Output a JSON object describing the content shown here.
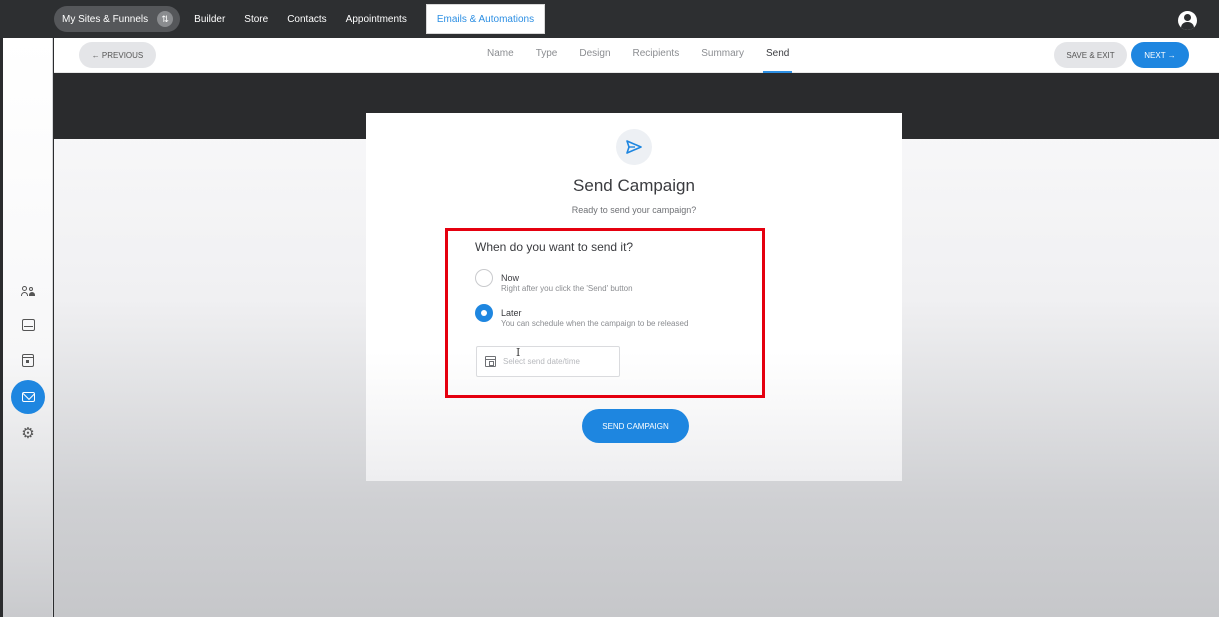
{
  "topnav": {
    "sites_label": "My Sites & Funnels",
    "items": [
      "Builder",
      "Store",
      "Contacts",
      "Appointments"
    ],
    "active_label": "Emails & Automations"
  },
  "toolbar": {
    "previous_label": "← PREVIOUS",
    "save_exit_label": "SAVE & EXIT",
    "next_label": "NEXT →"
  },
  "steps": [
    {
      "label": "Name",
      "active": false
    },
    {
      "label": "Type",
      "active": false
    },
    {
      "label": "Design",
      "active": false
    },
    {
      "label": "Recipients",
      "active": false
    },
    {
      "label": "Summary",
      "active": false
    },
    {
      "label": "Send",
      "active": true
    }
  ],
  "sidebar": {
    "icons": [
      "contacts-icon",
      "inbox-icon",
      "calendar-icon",
      "mail-icon",
      "settings-icon"
    ],
    "active": "mail-icon"
  },
  "card": {
    "title": "Send Campaign",
    "subtitle": "Ready to send your campaign?",
    "question": "When do you want to send it?",
    "options": [
      {
        "label": "Now",
        "description": "Right after you click the 'Send' button",
        "selected": false
      },
      {
        "label": "Later",
        "description": "You can schedule when the campaign to be released",
        "selected": true
      }
    ],
    "date_placeholder": "Select send date/time",
    "send_button": "SEND CAMPAIGN"
  },
  "colors": {
    "accent": "#1e86e0",
    "highlight_border": "#e5000f",
    "topbar": "#2d2f31"
  }
}
